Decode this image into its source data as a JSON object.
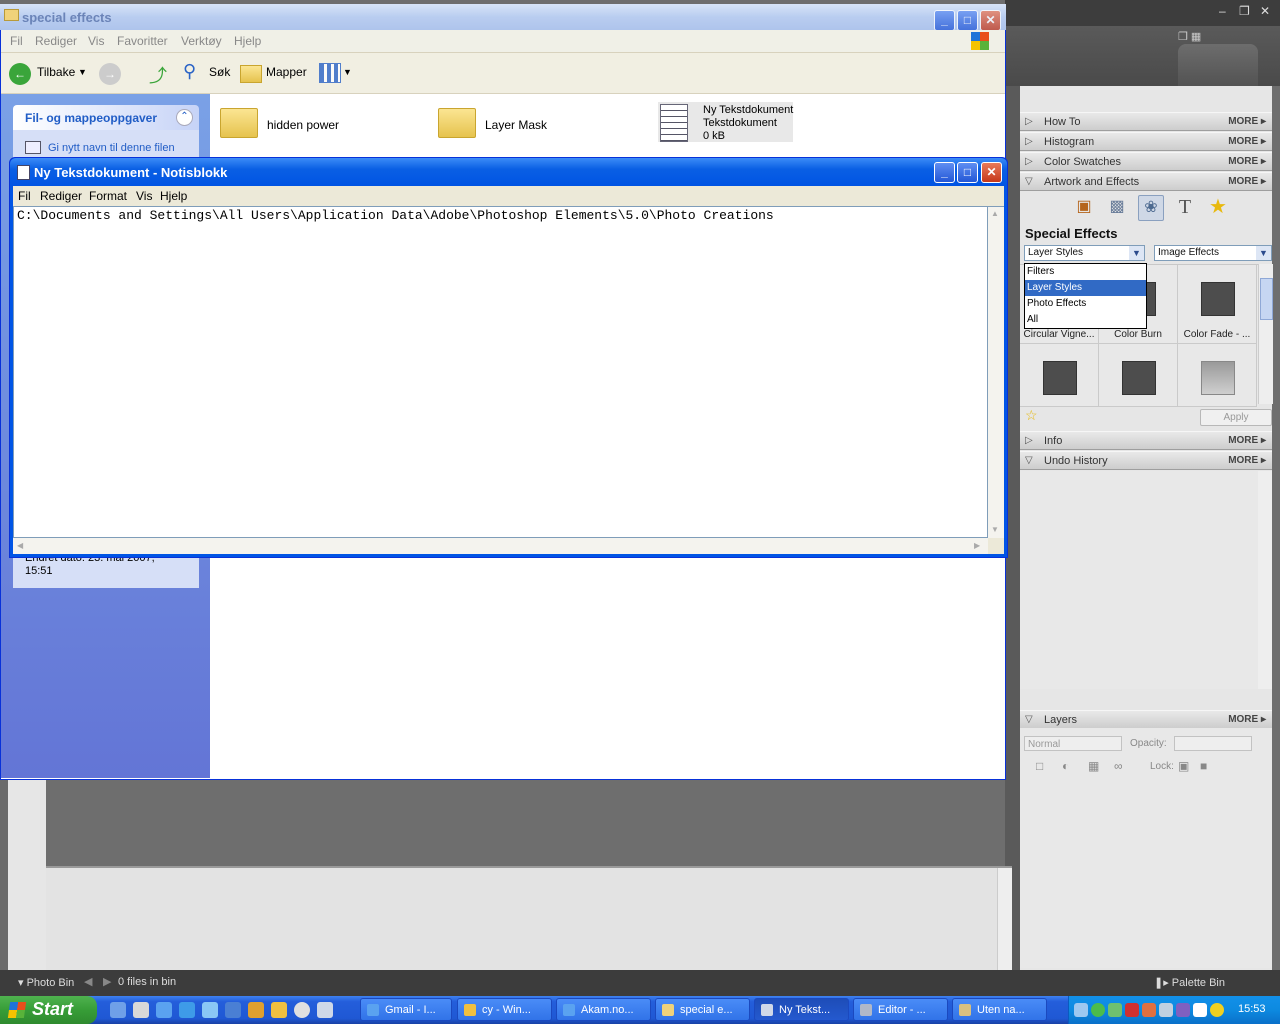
{
  "explorer": {
    "title": "special effects",
    "menu": [
      "Fil",
      "Rediger",
      "Vis",
      "Favoritter",
      "Verktøy",
      "Hjelp"
    ],
    "toolbar": {
      "back": "Tilbake",
      "search": "Søk",
      "folders": "Mapper"
    },
    "tasks_heading": "Fil- og mappeoppgaver",
    "task_rename": "Gi nytt navn til denne filen",
    "details": "Endret dato: 23. mai 2007, 15:51",
    "items": [
      {
        "name": "hidden power"
      },
      {
        "name": "Layer Mask"
      },
      {
        "name": "Ny Tekstdokument",
        "type": "Tekstdokument",
        "size": "0 kB"
      }
    ]
  },
  "notepad": {
    "title": "Ny Tekstdokument - Notisblokk",
    "menu": [
      "Fil",
      "Rediger",
      "Format",
      "Vis",
      "Hjelp"
    ],
    "content": "C:\\Documents and Settings\\All Users\\Application Data\\Adobe\\Photoshop Elements\\5.0\\Photo Creations"
  },
  "palette": {
    "panels": {
      "how_to": "How To",
      "histogram": "Histogram",
      "color_swatches": "Color Swatches",
      "artwork": "Artwork and Effects",
      "info": "Info",
      "undo": "Undo History",
      "layers": "Layers"
    },
    "more": "MORE",
    "special_effects_title": "Special Effects",
    "category_select": "Layer Styles",
    "effects_select": "Image Effects",
    "dropdown_options": [
      "Filters",
      "Layer Styles",
      "Photo Effects",
      "All"
    ],
    "dropdown_selected_index": 1,
    "thumbnails": [
      "Circular Vigne...",
      "Color Burn",
      "Color Fade - ...",
      "",
      "",
      ""
    ],
    "apply": "Apply",
    "layers": {
      "blend_mode": "Normal",
      "opacity_label": "Opacity:",
      "lock_label": "Lock:"
    }
  },
  "photobin": {
    "label": "Photo Bin",
    "files": "0 files in bin",
    "palette_bin": "Palette Bin"
  },
  "taskbar": {
    "start": "Start",
    "buttons": [
      "Gmail - I...",
      "cy - Win...",
      "Akam.no...",
      "special e...",
      "Ny Tekst...",
      "Editor - ...",
      "Uten na..."
    ],
    "active_index": 4,
    "clock": "15:53"
  }
}
